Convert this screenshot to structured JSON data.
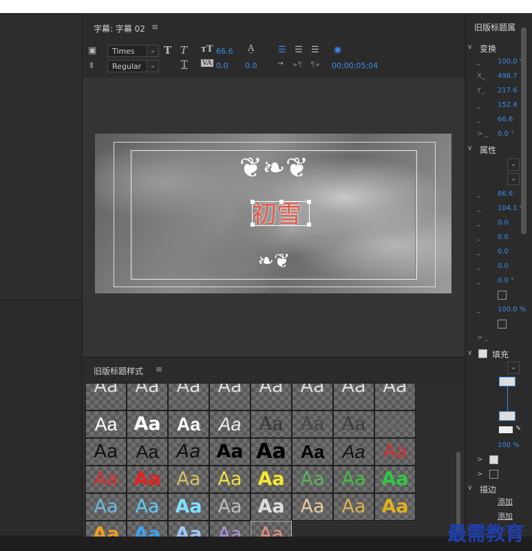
{
  "title_panel": {
    "title": "字幕: 字幕 02",
    "menu_icon": "≡",
    "font_family": "Times ...",
    "font_style": "Regular",
    "font_size": "66.6",
    "kerning": "0.0",
    "leading": "0.0",
    "timecode": "00;00;05;04",
    "title_text": "初雪"
  },
  "styles_panel": {
    "title": "旧版标题样式",
    "menu_icon": "≡",
    "sample": "Aa"
  },
  "properties_panel": {
    "title": "旧版标题属",
    "transform_section": "变换",
    "transform_rows": [
      {
        "label": "_",
        "value": "100.0 %"
      },
      {
        "label": "X_",
        "value": "498.7"
      },
      {
        "label": "Y_",
        "value": "217.6"
      },
      {
        "label": "_",
        "value": "152.4"
      },
      {
        "label": "_",
        "value": "66.6"
      },
      {
        "label": ">  _",
        "value": "0.0 °"
      }
    ],
    "attributes_section": "属性",
    "attributes_rows": [
      {
        "label": "_",
        "value": "66.6"
      },
      {
        "label": "_",
        "value": "104.1 %"
      },
      {
        "label": "_",
        "value": "0.0"
      },
      {
        "label": "_",
        "value": "0.0"
      },
      {
        "label": "_",
        "value": "0.0"
      },
      {
        "label": "_",
        "value": "0.0"
      },
      {
        "label": "_",
        "value": "0.0 °"
      },
      {
        "label": "_",
        "value": "100.0 %"
      }
    ],
    "fill_section": "填充",
    "fill_opacity": "100 %",
    "stroke_section": "描边",
    "add_label_1": "添加",
    "add_label_2": "添加"
  },
  "watermark": "最需教育",
  "colors": {
    "accent": "#3d8ee8",
    "title_text": "#e05a4a",
    "watermark": "#1f3fb0"
  }
}
